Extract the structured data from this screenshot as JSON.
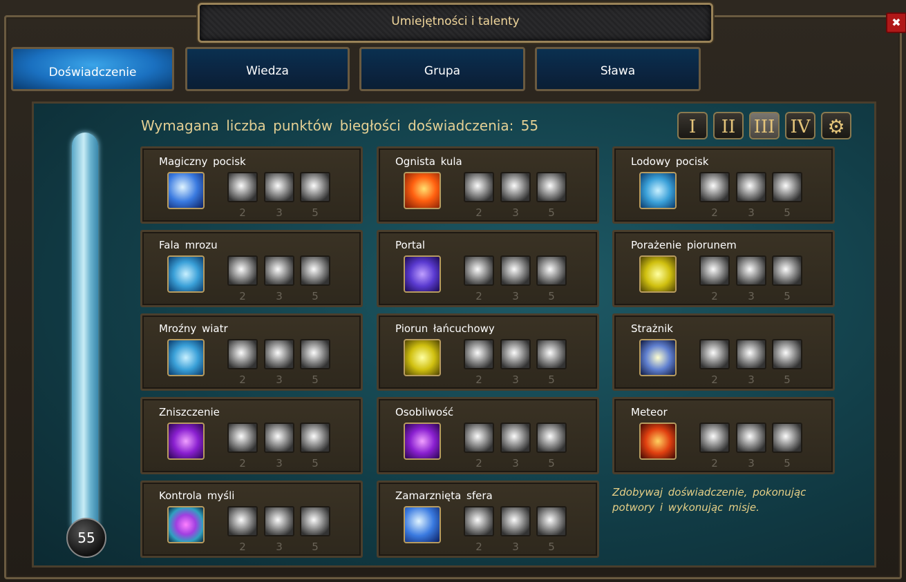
{
  "window": {
    "title": "Umiejętności i talenty",
    "close_label": "✖"
  },
  "tabs": [
    {
      "label": "Doświadczenie",
      "active": true
    },
    {
      "label": "Wiedza",
      "active": false
    },
    {
      "label": "Grupa",
      "active": false
    },
    {
      "label": "Sława",
      "active": false
    }
  ],
  "header": {
    "required_points": "Wymagana liczba punktów biegłości doświadczenia: 55"
  },
  "tiers": [
    "I",
    "II",
    "III",
    "IV"
  ],
  "selected_tier": "III",
  "xp": {
    "value": "55"
  },
  "skills": [
    {
      "name": "Magiczny pocisk",
      "levels": [
        "2",
        "3",
        "5"
      ]
    },
    {
      "name": "Fala mrozu",
      "levels": [
        "2",
        "3",
        "5"
      ]
    },
    {
      "name": "Mroźny wiatr",
      "levels": [
        "2",
        "3",
        "5"
      ]
    },
    {
      "name": "Zniszczenie",
      "levels": [
        "2",
        "3",
        "5"
      ]
    },
    {
      "name": "Kontrola myśli",
      "levels": [
        "2",
        "3",
        "5"
      ]
    },
    {
      "name": "Ognista kula",
      "levels": [
        "2",
        "3",
        "5"
      ]
    },
    {
      "name": "Portal",
      "levels": [
        "2",
        "3",
        "5"
      ]
    },
    {
      "name": "Piorun łańcuchowy",
      "levels": [
        "2",
        "3",
        "5"
      ]
    },
    {
      "name": "Osobliwość",
      "levels": [
        "2",
        "3",
        "5"
      ]
    },
    {
      "name": "Zamarznięta sfera",
      "levels": [
        "2",
        "3",
        "5"
      ]
    },
    {
      "name": "Lodowy pocisk",
      "levels": [
        "2",
        "3",
        "5"
      ]
    },
    {
      "name": "Porażenie piorunem",
      "levels": [
        "2",
        "3",
        "5"
      ]
    },
    {
      "name": "Strażnik",
      "levels": [
        "2",
        "3",
        "5"
      ]
    },
    {
      "name": "Meteor",
      "levels": [
        "2",
        "3",
        "5"
      ]
    }
  ],
  "hint": "Zdobywaj doświadczenie, pokonując potwory i wykonując misje."
}
